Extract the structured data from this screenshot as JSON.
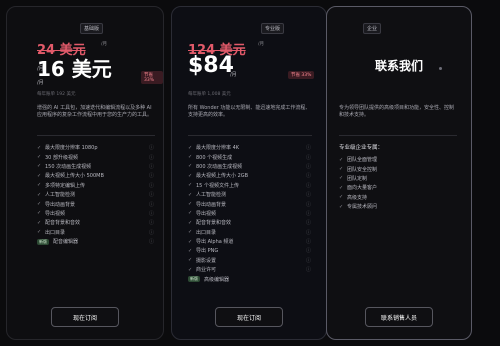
{
  "plans": [
    {
      "tier": "基础版",
      "old_price": "24 美元",
      "old_note": "/月",
      "price_main": "16 美元",
      "per_a": "/月",
      "per_b": "/月",
      "save_badge": "节省 33%",
      "billing_fine": "每年账单 192 美元",
      "desc": "增强的 AI 工具包，加速迭代和编辑流程以及多种 AI 应用程序的复杂工作流程中用于您的生产力的工具。",
      "features": [
        "最大限度分辨率 1080p",
        "30 部升级视频",
        "150 次动画生成视频",
        "最大视频上传大小 500MB",
        "多项特定编辑上传",
        "人工智能检测",
        "导出动画背景",
        "导出视频",
        "配音背景和音效",
        "出口目录"
      ],
      "new_badge": "新版",
      "new_feature": "配音编辑器",
      "cta": "现在订阅"
    },
    {
      "tier": "专业版",
      "old_price": "124 美元",
      "old_note": "/月",
      "price_main": "$84",
      "per_a": "/月",
      "save_badge": "节省 33%",
      "billing_fine": "每年账单 1,008 美元",
      "desc": "所有 Wonder 功能以无限制、能迅速地完成工作流程、支持更高的效率。",
      "features": [
        "最大限度分辨率 4K",
        "800 个视频生成",
        "800 次动画生成视频",
        "最大视频上传大小 2GB",
        "15 个视频文件上传",
        "人工智能检测",
        "导出动画背景",
        "导出视频",
        "配音背景和音效",
        "出口目录",
        "导出 Alpha 频道",
        "导出 PNG",
        "摄影设置",
        "商业许可"
      ],
      "new_badge": "新版",
      "new_feature": "高级编辑器",
      "cta": "现在订阅"
    },
    {
      "tier": "企业",
      "title": "联系我们",
      "desc": "专为领导团队提供的高级项目和功能，安全性、控制和技术支持。",
      "heading": "专业级企业专属：",
      "features": [
        "团队全面管理",
        "团队安全控制",
        "团队定制",
        "面向大量客户",
        "高级支持",
        "专属技术顾问"
      ],
      "cta": "联系销售人员"
    }
  ],
  "colors": {
    "bg": "#0b0b0d",
    "card": "#0e0e11",
    "accent_strike": "#e25a6a",
    "new_badge": "#2d4a34"
  }
}
